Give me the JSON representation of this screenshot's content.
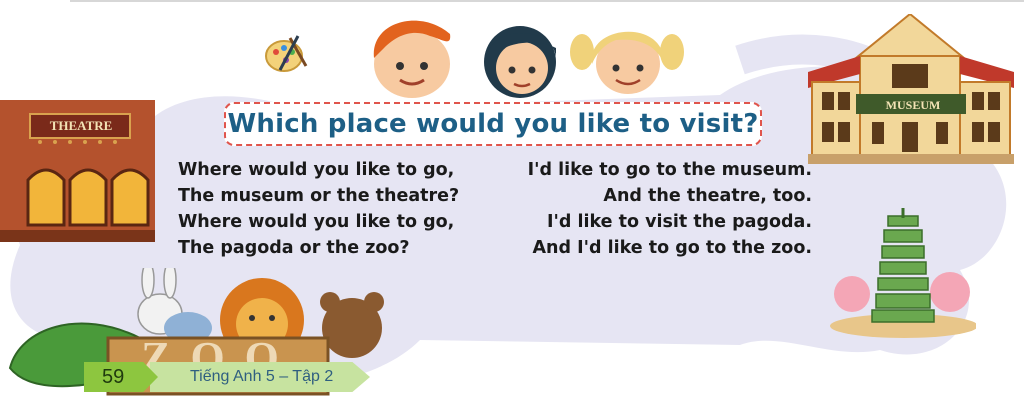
{
  "title": "Which place would you like to visit?",
  "poem": {
    "left": [
      "Where would you like to go,",
      "The museum or the theatre?",
      "Where would you like to go,",
      "The pagoda or the zoo?"
    ],
    "right": [
      "I'd like to go to the museum.",
      "And the theatre, too.",
      "I'd like to visit the pagoda.",
      "And I'd like to go to the zoo."
    ]
  },
  "signs": {
    "theatre": "THEATRE",
    "museum": "MUSEUM",
    "zoo": "ZOO"
  },
  "footer": {
    "page_number": "59",
    "book_title": "Tiếng Anh 5 – Tập 2"
  },
  "colors": {
    "title_text": "#1d5f86",
    "title_border": "#e0554c",
    "cloud": "#e6e5f3",
    "page_tab": "#8dc63f",
    "book_tab": "#c7e3a0"
  }
}
